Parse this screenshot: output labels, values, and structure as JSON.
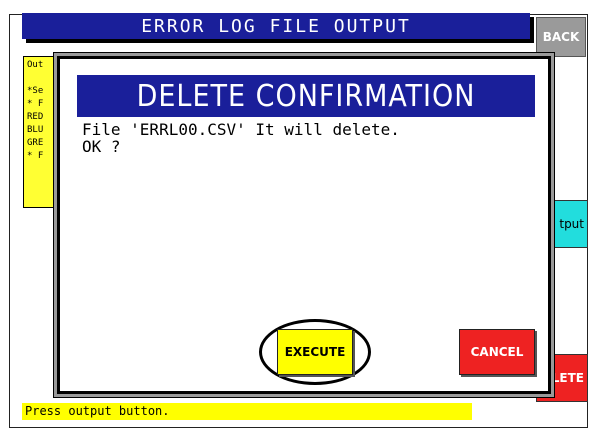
{
  "screen": {
    "title": "ERROR LOG FILE OUTPUT",
    "back_label": "BACK",
    "info_panel_text": "Out\n\n*Se\n* F\nRED\nBLU\nGRE\n* F",
    "output_label": "tput",
    "delete_label": "LETE",
    "status_text": "Press output button."
  },
  "dialog": {
    "title": "DELETE CONFIRMATION",
    "message": "File 'ERRL00.CSV' It will delete.\nOK ?",
    "execute_label": "EXECUTE",
    "cancel_label": "CANCEL"
  },
  "colors": {
    "title_blue": "#1a1f9a",
    "info_yellow": "#ffff33",
    "output_cyan": "#22dddd",
    "delete_red": "#ee2222",
    "back_gray": "#9a9a9a"
  }
}
